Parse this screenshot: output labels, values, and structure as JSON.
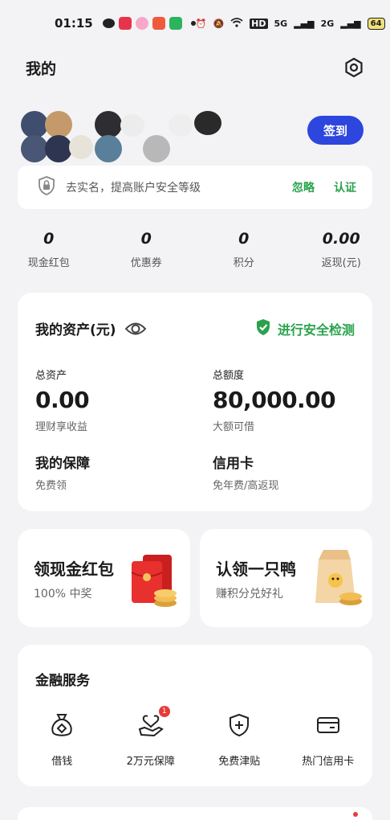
{
  "status_bar": {
    "time": "01:15",
    "network_labels": [
      "HD",
      "5G",
      "2G"
    ],
    "battery": "64"
  },
  "header": {
    "title": "我的"
  },
  "profile": {
    "signin_label": "签到"
  },
  "security": {
    "text": "去实名，提高账户安全等级",
    "ignore_label": "忽略",
    "verify_label": "认证"
  },
  "stats": [
    {
      "value": "0",
      "label": "现金红包"
    },
    {
      "value": "0",
      "label": "优惠券"
    },
    {
      "value": "0",
      "label": "积分"
    },
    {
      "value": "0.00",
      "label": "返现(元)"
    }
  ],
  "assets": {
    "title": "我的资产(元)",
    "security_check": "进行安全检测",
    "total_assets_label": "总资产",
    "total_assets_value": "0.00",
    "total_assets_sub": "理财享收益",
    "total_credit_label": "总额度",
    "total_credit_value": "80,000.00",
    "total_credit_sub": "大额可借",
    "protection_label": "我的保障",
    "protection_sub": "免费领",
    "credit_card_label": "信用卡",
    "credit_card_sub": "免年费/高返现"
  },
  "promos": [
    {
      "title": "领现金红包",
      "subtitle": "100% 中奖"
    },
    {
      "title": "认领一只鸭",
      "subtitle": "赚积分兑好礼"
    }
  ],
  "services": {
    "title": "金融服务",
    "items": [
      {
        "label": "借钱",
        "icon": "money-bag-icon"
      },
      {
        "label": "2万元保障",
        "icon": "hand-heart-icon",
        "badge": "1"
      },
      {
        "label": "免费津贴",
        "icon": "shield-plus-icon"
      },
      {
        "label": "热门信用卡",
        "icon": "credit-card-icon"
      }
    ]
  },
  "colors": {
    "accent_blue": "#2d46dd",
    "green": "#2aa24c",
    "red": "#e83a3a"
  }
}
